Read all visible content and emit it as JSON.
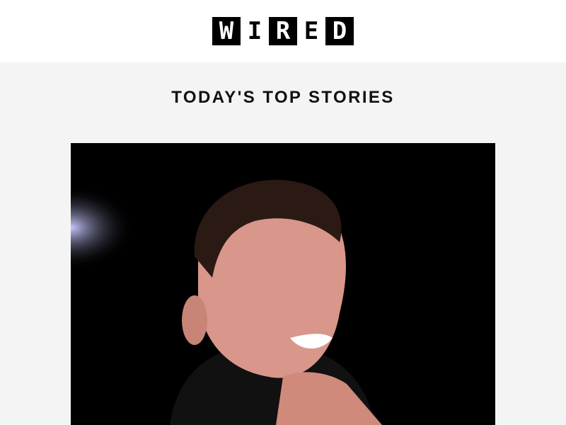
{
  "logo": {
    "letters": [
      "W",
      "I",
      "R",
      "E",
      "D"
    ],
    "text": "WIRED"
  },
  "section": {
    "title": "TODAY'S TOP STORIES"
  },
  "hero_image": {
    "alt": "Photo of a smiling man with hand on chin against a black background"
  },
  "colors": {
    "header_bg": "#ffffff",
    "body_bg": "#f4f4f4",
    "logo": "#000000"
  }
}
